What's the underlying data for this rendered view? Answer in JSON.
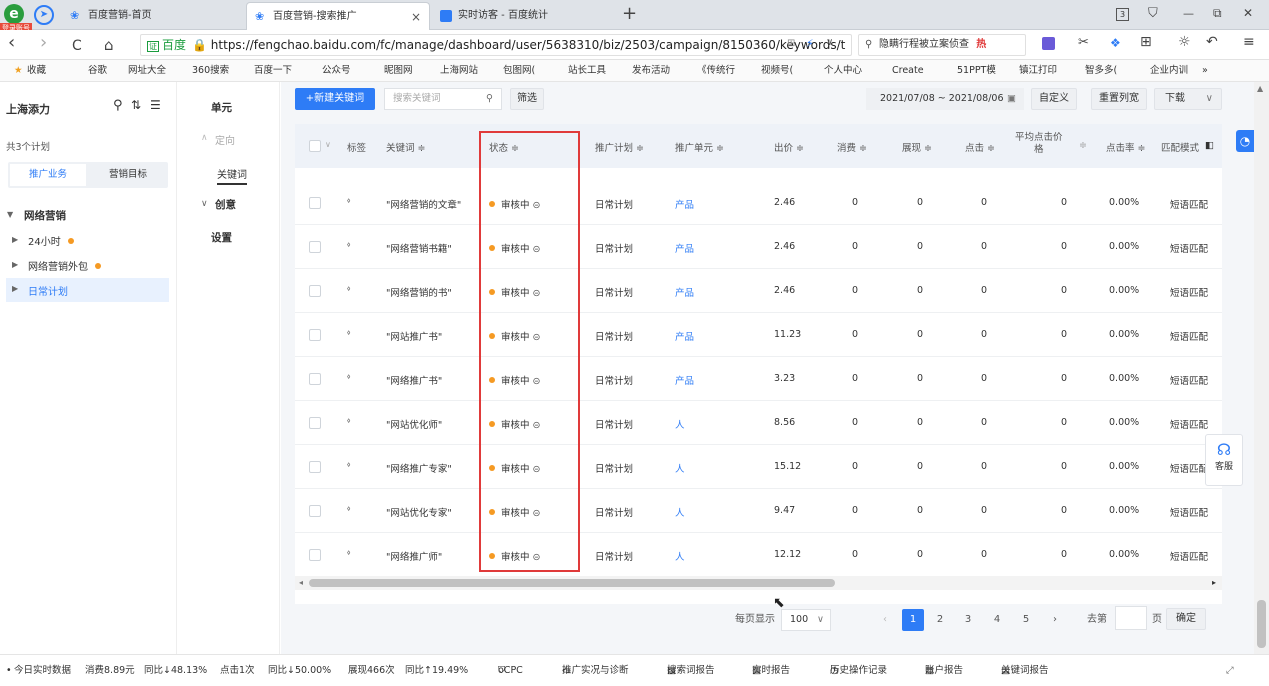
{
  "browser": {
    "tabs": [
      {
        "title": "百度营销-首页"
      },
      {
        "title": "百度营销-搜索推广"
      },
      {
        "title": "实时访客 - 百度统计"
      }
    ],
    "new_tab": "+",
    "badge": "登录账号",
    "back": "‹",
    "forward": "›",
    "reload": "C",
    "home": "⌂",
    "baidu_label": "百度",
    "url": "https://fengchao.baidu.com/fc/manage/dashboard/user/5638310/biz/2503/campaign/8150360/keywords/t",
    "search_text": "隐瞒行程被立案侦查",
    "hot_label": "热",
    "window_controls": {
      "minimize": "—",
      "restore": "⧉",
      "close": "✕"
    },
    "tab_count": "3",
    "bookmarks": [
      "收藏",
      "谷歌",
      "网址大全",
      "360搜索",
      "百度一下",
      "公众号",
      "昵图网",
      "上海网站",
      "包图网(",
      "站长工具",
      "发布活动",
      "《传统行",
      "视频号(",
      "个人中心",
      "Create",
      "51PPT模",
      "镇江打印",
      "智多多(",
      "企业内训",
      "»"
    ]
  },
  "sidebar": {
    "account": "上海添力",
    "plan_count": "共3个计划",
    "tabs": [
      "推广业务",
      "营销目标"
    ],
    "group": "网络营销",
    "items": [
      {
        "label": "24小时"
      },
      {
        "label": "网络营销外包"
      },
      {
        "label": "日常计划"
      }
    ]
  },
  "midnav": {
    "unit": "单元",
    "target": "定向",
    "keyword": "关键词",
    "creative": "创意",
    "settings": "设置"
  },
  "toolbar": {
    "new_keyword": "+新建关键词",
    "search_placeholder": "搜索关键词",
    "filter": "筛选",
    "date_range": "2021/07/08 ~ 2021/08/06",
    "customize": "自定义",
    "reset_columns": "重置列宽",
    "download": "下载"
  },
  "table": {
    "headers": {
      "tag": "标签",
      "keyword": "关键词 ≑",
      "status": "状态 ≑",
      "plan": "推广计划 ≑",
      "unit": "推广单元 ≑",
      "bid": "出价 ≑",
      "cost": "消费 ≑",
      "impressions": "展现 ≑",
      "clicks": "点击 ≑",
      "avg_cpc_line1": "平均点击价",
      "avg_cpc_line2": "格",
      "ctr": "点击率 ≑",
      "match": "匹配模式"
    },
    "rows": [
      {
        "keyword": "\"网络营销的文章\"",
        "status": "审核中",
        "plan": "日常计划",
        "unit": "产品",
        "bid": "2.46",
        "cost": "0",
        "impressions": "0",
        "clicks": "0",
        "avg_cpc": "0",
        "ctr": "0.00%",
        "match": "短语匹配"
      },
      {
        "keyword": "\"网络营销书籍\"",
        "status": "审核中",
        "plan": "日常计划",
        "unit": "产品",
        "bid": "2.46",
        "cost": "0",
        "impressions": "0",
        "clicks": "0",
        "avg_cpc": "0",
        "ctr": "0.00%",
        "match": "短语匹配"
      },
      {
        "keyword": "\"网络营销的书\"",
        "status": "审核中",
        "plan": "日常计划",
        "unit": "产品",
        "bid": "2.46",
        "cost": "0",
        "impressions": "0",
        "clicks": "0",
        "avg_cpc": "0",
        "ctr": "0.00%",
        "match": "短语匹配"
      },
      {
        "keyword": "\"网站推广书\"",
        "status": "审核中",
        "plan": "日常计划",
        "unit": "产品",
        "bid": "11.23",
        "cost": "0",
        "impressions": "0",
        "clicks": "0",
        "avg_cpc": "0",
        "ctr": "0.00%",
        "match": "短语匹配"
      },
      {
        "keyword": "\"网络推广书\"",
        "status": "审核中",
        "plan": "日常计划",
        "unit": "产品",
        "bid": "3.23",
        "cost": "0",
        "impressions": "0",
        "clicks": "0",
        "avg_cpc": "0",
        "ctr": "0.00%",
        "match": "短语匹配"
      },
      {
        "keyword": "\"网站优化师\"",
        "status": "审核中",
        "plan": "日常计划",
        "unit": "人",
        "bid": "8.56",
        "cost": "0",
        "impressions": "0",
        "clicks": "0",
        "avg_cpc": "0",
        "ctr": "0.00%",
        "match": "短语匹配"
      },
      {
        "keyword": "\"网络推广专家\"",
        "status": "审核中",
        "plan": "日常计划",
        "unit": "人",
        "bid": "15.12",
        "cost": "0",
        "impressions": "0",
        "clicks": "0",
        "avg_cpc": "0",
        "ctr": "0.00%",
        "match": "短语匹配"
      },
      {
        "keyword": "\"网站优化专家\"",
        "status": "审核中",
        "plan": "日常计划",
        "unit": "人",
        "bid": "9.47",
        "cost": "0",
        "impressions": "0",
        "clicks": "0",
        "avg_cpc": "0",
        "ctr": "0.00%",
        "match": "短语匹配"
      },
      {
        "keyword": "\"网络推广师\"",
        "status": "审核中",
        "plan": "日常计划",
        "unit": "人",
        "bid": "12.12",
        "cost": "0",
        "impressions": "0",
        "clicks": "0",
        "avg_cpc": "0",
        "ctr": "0.00%",
        "match": "短语匹配"
      }
    ]
  },
  "pagination": {
    "per_page_label": "每页显示",
    "per_page": "100",
    "pages": [
      "1",
      "2",
      "3",
      "4",
      "5"
    ],
    "current": "1",
    "goto_label": "去第",
    "page_unit": "页",
    "confirm": "确定"
  },
  "support": "客服",
  "statusbar": {
    "label": "今日实时数据",
    "cost": "消费8.89元",
    "cost_change": "同比↓48.13%",
    "clicks": "点击1次",
    "clicks_change": "同比↓50.00%",
    "impressions": "展现466次",
    "impressions_change": "同比↑19.49%",
    "links": [
      "oCPC",
      "推广实况与诊断",
      "搜索词报告",
      "实时报告",
      "历史操作记录",
      "账户报告",
      "关键词报告"
    ]
  },
  "colors": {
    "accent": "#2e7cf6",
    "status_dot": "#f59a23",
    "highlight_border": "#e03a3a"
  }
}
